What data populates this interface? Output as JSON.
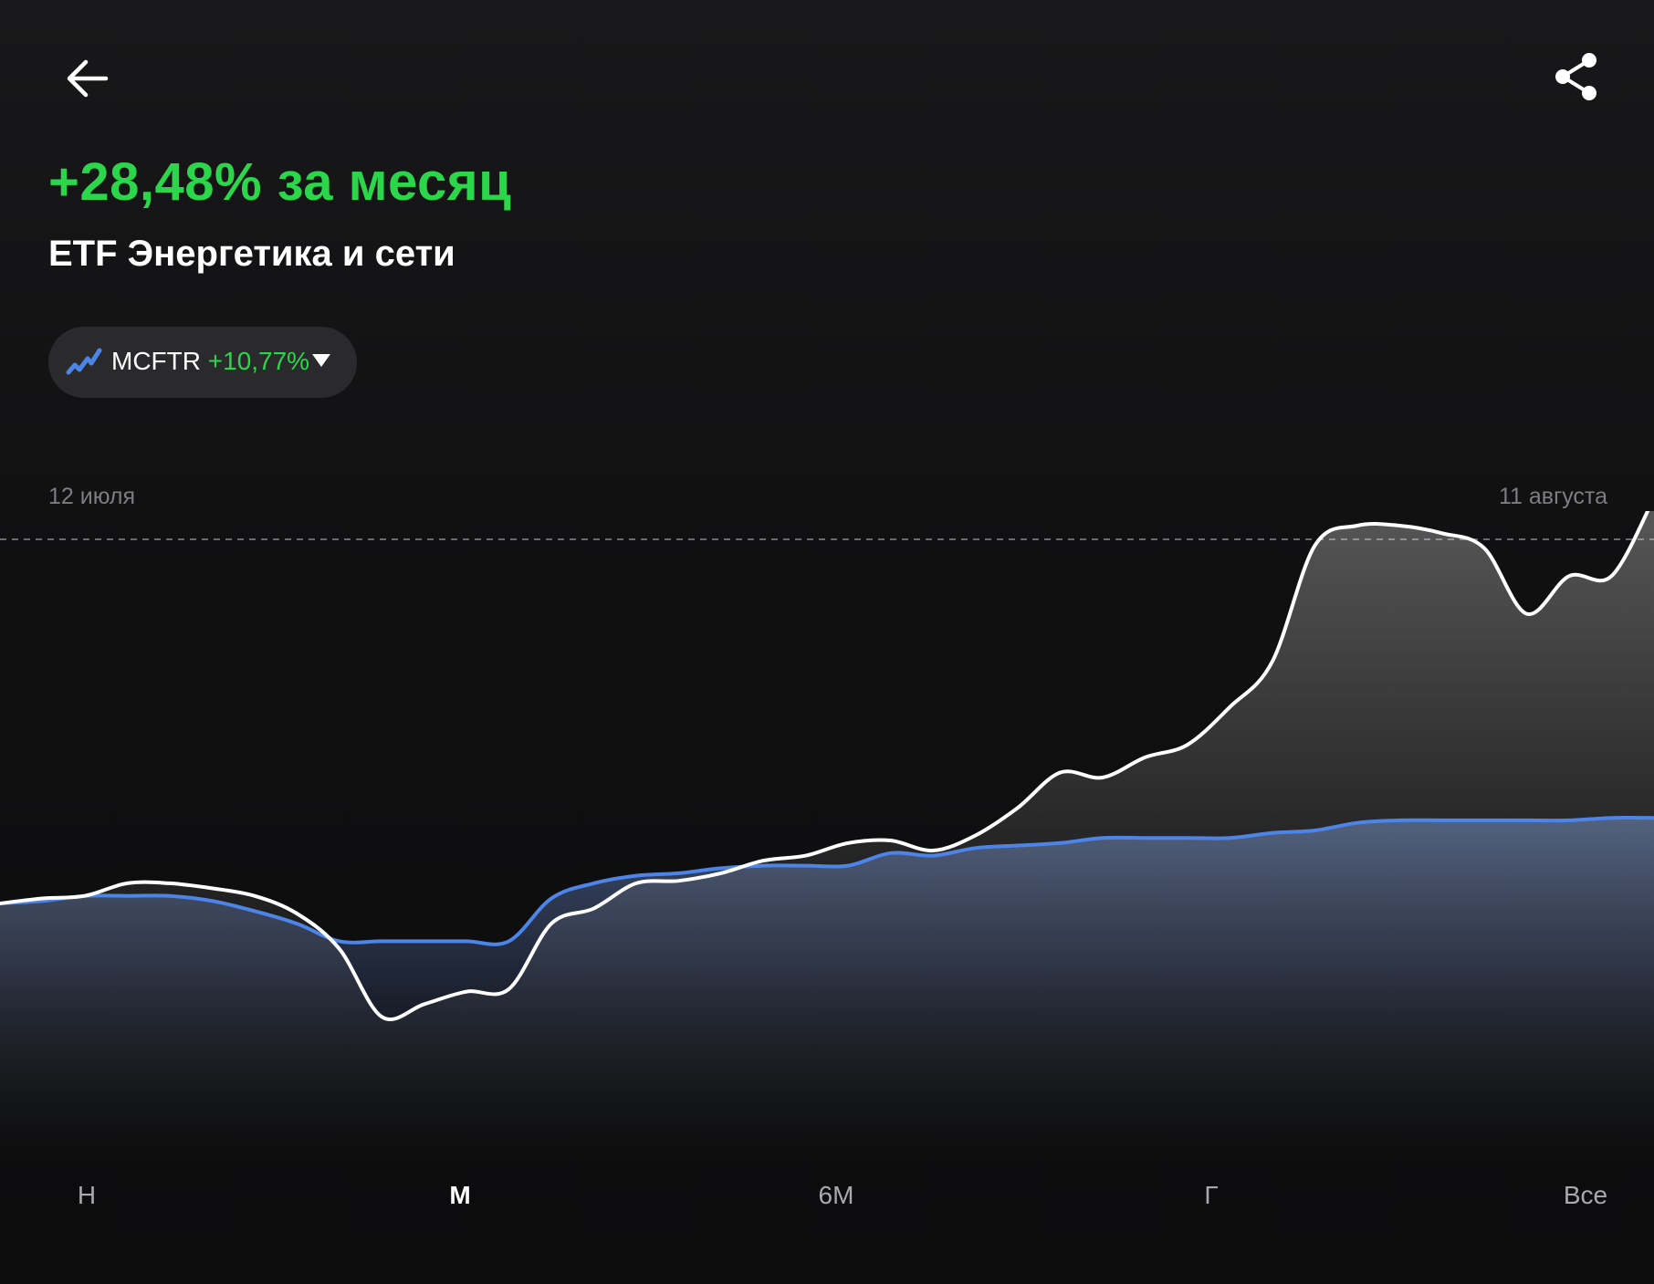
{
  "header": {
    "back_icon": "arrow-left-icon",
    "share_icon": "share-icon"
  },
  "summary": {
    "change": "+28,48% за месяц",
    "instrument": "ETF Энергетика и сети"
  },
  "compare": {
    "icon": "chart-line-icon",
    "ticker": "MCFTR",
    "change": "+10,77%",
    "dropdown_icon": "triangle-down-icon"
  },
  "dates": {
    "start": "12 июля",
    "end": "11 августа"
  },
  "colors": {
    "positive": "#2bd64b",
    "fund_line": "#ffffff",
    "benchmark_line": "#4d84e8",
    "chip_background": "#2a2a2d"
  },
  "periods": {
    "week": "Н",
    "month": "М",
    "half_year": "6М",
    "year": "Г",
    "all": "Все",
    "selected": "М"
  },
  "chart_data": {
    "type": "line",
    "title": "",
    "xlabel": "",
    "ylabel": "",
    "x_range": [
      "12 июля",
      "11 августа"
    ],
    "y_unit": "% change",
    "baseline_dashed_line": true,
    "grid": false,
    "series": [
      {
        "name": "ETF Энергетика и сети",
        "color": "#ffffff",
        "values": [
          0,
          0.2,
          0.3,
          0.8,
          0.8,
          0.6,
          0.3,
          -0.4,
          -1.8,
          -4.5,
          -4.0,
          -3.5,
          -3.4,
          -0.8,
          -0.2,
          0.8,
          0.9,
          1.2,
          1.7,
          1.9,
          2.4,
          2.5,
          2.1,
          2.7,
          3.8,
          5.2,
          5.0,
          5.8,
          6.3,
          7.8,
          9.6,
          14.2,
          15.0,
          15.0,
          14.7,
          14.1,
          11.5,
          13.0,
          13.0,
          16.1
        ]
      },
      {
        "name": "MCFTR",
        "color": "#4d84e8",
        "values": [
          0,
          0.1,
          0.3,
          0.3,
          0.3,
          0.1,
          -0.3,
          -0.8,
          -1.5,
          -1.5,
          -1.5,
          -1.5,
          -1.5,
          0.2,
          0.8,
          1.1,
          1.2,
          1.4,
          1.5,
          1.5,
          1.5,
          2.0,
          1.9,
          2.2,
          2.3,
          2.4,
          2.6,
          2.6,
          2.6,
          2.6,
          2.8,
          2.9,
          3.2,
          3.3,
          3.3,
          3.3,
          3.3,
          3.3,
          3.4,
          3.4
        ]
      }
    ]
  }
}
